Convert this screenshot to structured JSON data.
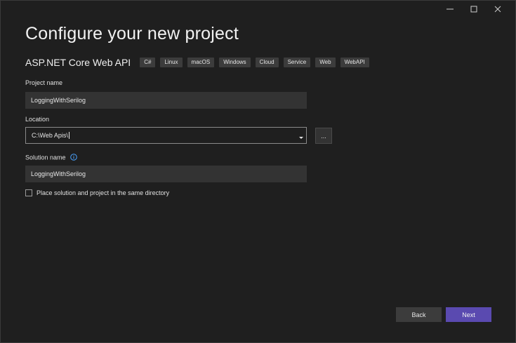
{
  "window": {
    "controls": {
      "minimize": "minimize-icon",
      "maximize": "maximize-icon",
      "close": "close-icon"
    }
  },
  "header": {
    "title": "Configure your new project",
    "template_name": "ASP.NET Core Web API",
    "tags": [
      "C#",
      "Linux",
      "macOS",
      "Windows",
      "Cloud",
      "Service",
      "Web",
      "WebAPI"
    ]
  },
  "form": {
    "project_name": {
      "label": "Project name",
      "value": "LoggingWithSerilog"
    },
    "location": {
      "label": "Location",
      "value": "C:\\Web Apis\\",
      "browse_label": "..."
    },
    "solution_name": {
      "label": "Solution name",
      "value": "LoggingWithSerilog"
    },
    "same_directory": {
      "label": "Place solution and project in the same directory",
      "checked": false
    }
  },
  "footer": {
    "back_label": "Back",
    "next_label": "Next"
  },
  "colors": {
    "accent": "#5a4ab0",
    "background": "#1f1f1f",
    "field": "#333333",
    "tag": "#3c3c3c"
  }
}
